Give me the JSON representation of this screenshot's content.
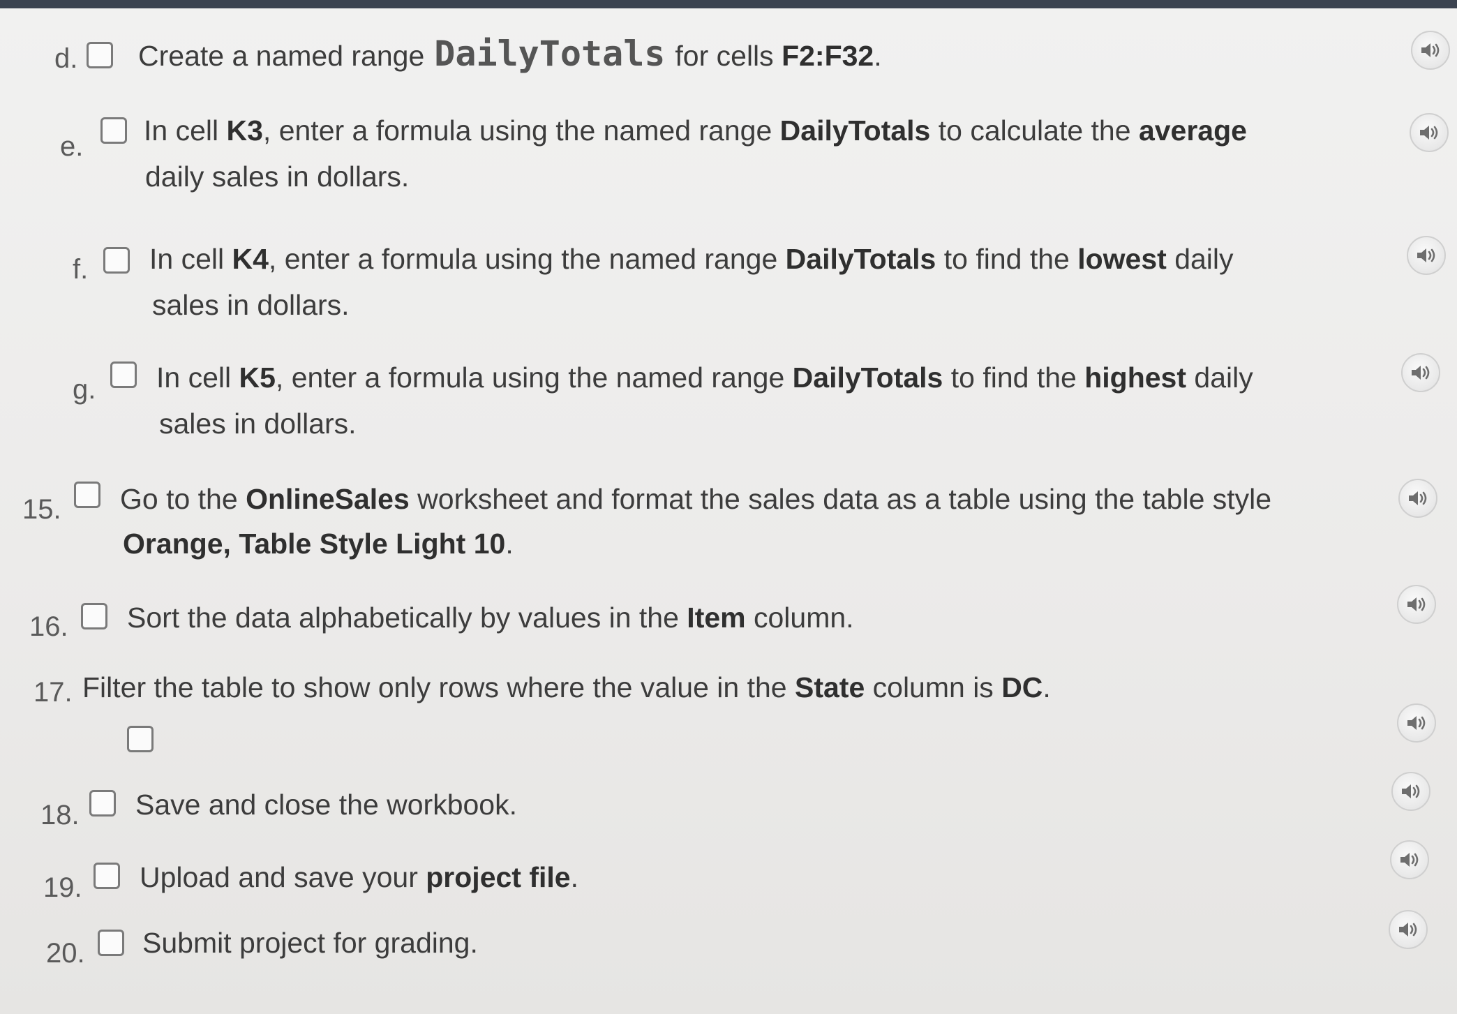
{
  "steps": [
    {
      "number": "d.",
      "parts": [
        {
          "t": "Create a named range"
        },
        {
          "t": "DailyTotals",
          "code": true
        },
        {
          "t": "for cells "
        },
        {
          "t": "F2:F32",
          "b": true
        },
        {
          "t": "."
        }
      ]
    },
    {
      "number": "e.",
      "parts": [
        {
          "t": "In cell "
        },
        {
          "t": "K3",
          "b": true
        },
        {
          "t": ", enter a formula using the named range "
        },
        {
          "t": "DailyTotals",
          "b": true
        },
        {
          "t": " to calculate the "
        },
        {
          "t": "average",
          "b": true
        }
      ],
      "line2": "daily sales in dollars."
    },
    {
      "number": "f.",
      "parts": [
        {
          "t": "In cell "
        },
        {
          "t": "K4",
          "b": true
        },
        {
          "t": ", enter a formula using the named range "
        },
        {
          "t": "DailyTotals",
          "b": true
        },
        {
          "t": " to find the "
        },
        {
          "t": "lowest",
          "b": true
        },
        {
          "t": " daily"
        }
      ],
      "line2": "sales in dollars."
    },
    {
      "number": "g.",
      "parts": [
        {
          "t": "In cell "
        },
        {
          "t": "K5",
          "b": true
        },
        {
          "t": ", enter a formula using the named range "
        },
        {
          "t": "DailyTotals",
          "b": true
        },
        {
          "t": " to find the "
        },
        {
          "t": "highest",
          "b": true
        },
        {
          "t": " daily"
        }
      ],
      "line2": "sales in dollars."
    },
    {
      "number": "15.",
      "parts": [
        {
          "t": "Go to the "
        },
        {
          "t": "OnlineSales",
          "b": true
        },
        {
          "t": " worksheet and format the sales data as a table using the table style"
        }
      ],
      "line2": "Orange, Table Style Light 10",
      "line2_bold": true,
      "line2_suffix": "."
    },
    {
      "number": "16.",
      "parts": [
        {
          "t": "Sort the data alphabetically by values in the "
        },
        {
          "t": "Item",
          "b": true
        },
        {
          "t": " column."
        }
      ]
    },
    {
      "number": "17.",
      "parts": [
        {
          "t": "Filter the table to show only rows where the value in the "
        },
        {
          "t": "State",
          "b": true
        },
        {
          "t": " column is "
        },
        {
          "t": "DC",
          "b": true
        },
        {
          "t": "."
        }
      ]
    },
    {
      "number": "18.",
      "parts": [
        {
          "t": "Save and close the workbook."
        }
      ]
    },
    {
      "number": "19.",
      "parts": [
        {
          "t": "Upload and save your "
        },
        {
          "t": "project file",
          "b": true
        },
        {
          "t": "."
        }
      ]
    },
    {
      "number": "20.",
      "parts": [
        {
          "t": "Submit project for grading."
        }
      ]
    }
  ],
  "icons": {
    "checkbox": "checkbox-icon",
    "audio": "speaker-icon"
  }
}
